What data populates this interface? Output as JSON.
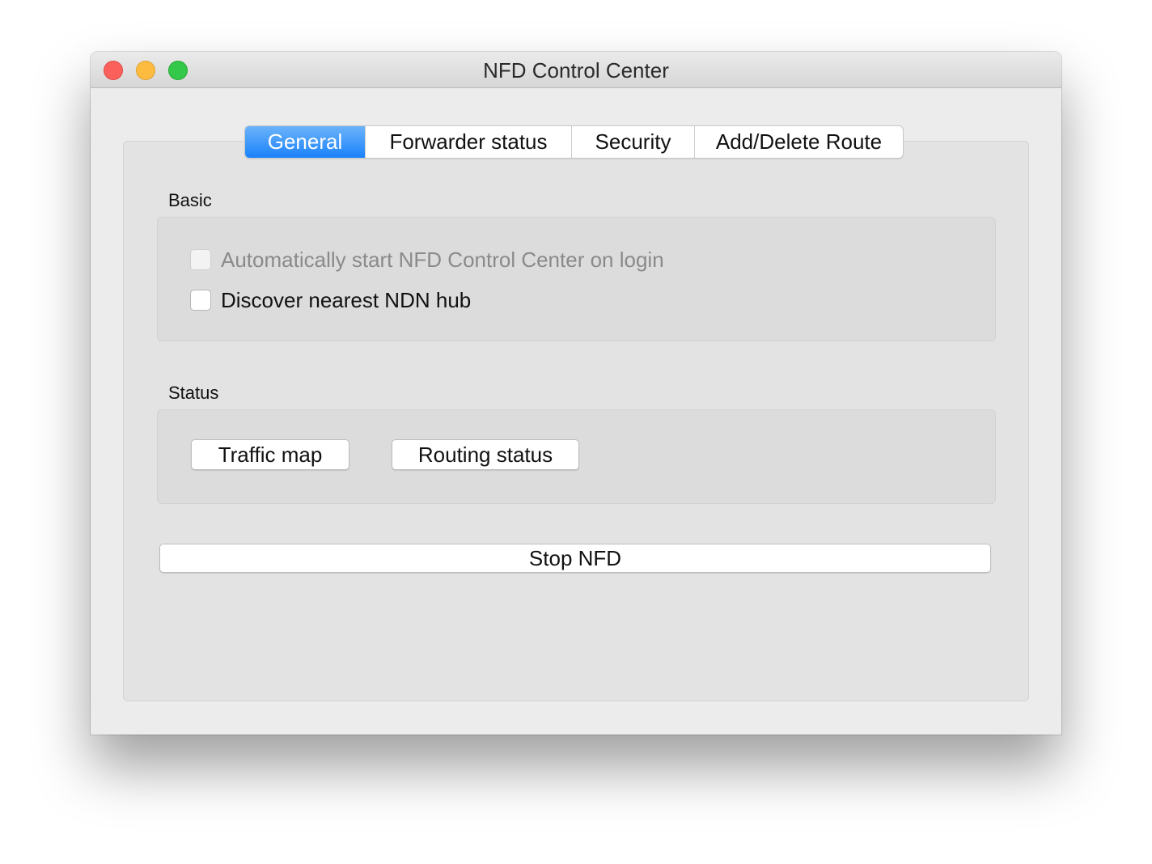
{
  "window": {
    "title": "NFD Control Center",
    "controls": {
      "close_icon": "close-icon",
      "minimize_icon": "minimize-icon",
      "zoom_icon": "zoom-icon"
    }
  },
  "tabs": [
    {
      "label": "General",
      "active": true
    },
    {
      "label": "Forwarder status",
      "active": false
    },
    {
      "label": "Security",
      "active": false
    },
    {
      "label": "Add/Delete Route",
      "active": false
    }
  ],
  "general": {
    "basic": {
      "label": "Basic",
      "options": [
        {
          "label": "Automatically start NFD Control Center on login",
          "checked": false,
          "enabled": false
        },
        {
          "label": "Discover nearest NDN hub",
          "checked": false,
          "enabled": true
        }
      ]
    },
    "status": {
      "label": "Status",
      "buttons": [
        "Traffic map",
        "Routing status"
      ]
    },
    "stop_button": "Stop NFD"
  },
  "colors": {
    "active_tab": "#1a82fb",
    "window_bg": "#ececec",
    "close": "#fc605b",
    "minimize": "#fdbc40",
    "zoom": "#34c84a"
  }
}
